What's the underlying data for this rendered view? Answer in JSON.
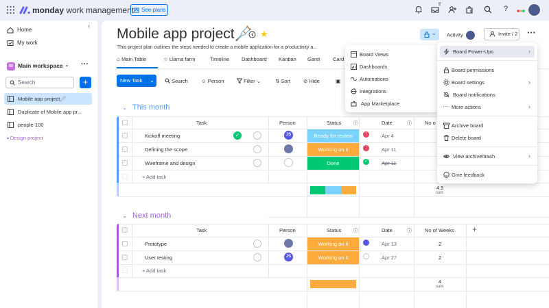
{
  "topbar": {
    "logo_brand": "monday",
    "logo_product": "work management",
    "see_plans": "See plans",
    "inbox_badge": "5"
  },
  "sidebar": {
    "home": "Home",
    "my_work": "My work",
    "workspace_initial": "M",
    "workspace_name": "Main workspace",
    "search_placeholder": "Search",
    "add_label": "+",
    "boards": [
      {
        "label": "Mobile app project🩼",
        "active": true
      },
      {
        "label": "Duplicate of Mobile app pr..."
      },
      {
        "label": "people-100"
      }
    ],
    "folder": "Design project"
  },
  "board": {
    "title": "Mobile app project🩼",
    "description": "This project plan outlines the steps needed to create a mobile application for a productivity a...",
    "activity": "Activity",
    "invite": "Invite / 2",
    "tabs": [
      "Main Table",
      "Llama farm",
      "Timeline",
      "Dashboard",
      "Kanban",
      "Gantt",
      "Card"
    ],
    "toolbar": {
      "new_task": "New Task",
      "search": "Search",
      "person": "Person",
      "filter": "Filter",
      "sort": "Sort",
      "hide": "Hide"
    }
  },
  "columns": {
    "task": "Task",
    "person": "Person",
    "status": "Status",
    "date": "Date",
    "weeks": "No of Weeks",
    "weeks_truncated": "No o"
  },
  "groups": [
    {
      "title": "This month",
      "color": "#579bfc",
      "rows": [
        {
          "task": "Kickoff meeting",
          "person": "JS",
          "status": "Ready for review",
          "status_color": "#7ad3fc",
          "date": "Apr 4"
        },
        {
          "task": "Defining the scope",
          "person": "avatar",
          "status": "Working on it",
          "status_color": "#fdab3d",
          "date": "Apr 11"
        },
        {
          "task": "Wireframe and design",
          "person": "",
          "status": "Done",
          "status_color": "#00c875",
          "date": "Apr 11"
        }
      ],
      "add_task": "+ Add task",
      "sum_value": "4.5",
      "sum_label": "sum"
    },
    {
      "title": "Next month",
      "color": "#a25ddc",
      "rows": [
        {
          "task": "Prototype",
          "person": "avatar",
          "status": "Working on it",
          "status_color": "#fdab3d",
          "date": "Apr 13",
          "weeks": "2"
        },
        {
          "task": "User testing",
          "person": "JS",
          "status": "Working on it",
          "status_color": "#fdab3d",
          "date": "Apr 27",
          "weeks": "2"
        }
      ],
      "add_task": "+ Add task",
      "sum_value": "4",
      "sum_label": "sum"
    }
  ],
  "colors": {
    "primary": "#0073ea",
    "done": "#00c875",
    "working": "#fdab3d",
    "ready": "#7ad3fc",
    "alert": "#e2445c"
  },
  "powerups_menu": {
    "items": [
      "Board Views",
      "Dashboards",
      "Automations",
      "Integrations",
      "App Marketplace"
    ]
  },
  "board_menu": {
    "items": [
      "Board Power-Ups",
      "Board permissions",
      "Board settings",
      "Board notifications",
      "More actions",
      "Archive board",
      "Delete board",
      "View archive/trash",
      "Give feedback"
    ]
  }
}
